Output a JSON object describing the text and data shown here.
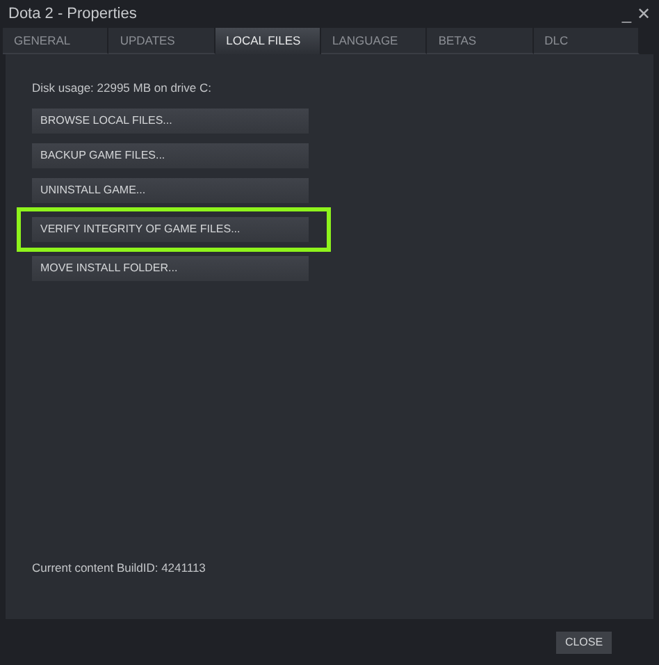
{
  "window": {
    "title": "Dota 2 - Properties",
    "controls": [
      "_",
      "✕"
    ]
  },
  "tabs": [
    {
      "label": "GENERAL",
      "selected": false
    },
    {
      "label": "UPDATES",
      "selected": false
    },
    {
      "label": "LOCAL FILES",
      "selected": true
    },
    {
      "label": "LANGUAGE",
      "selected": false
    },
    {
      "label": "BETAS",
      "selected": false
    },
    {
      "label": "DLC",
      "selected": false
    }
  ],
  "disk_usage": "Disk usage: 22995 MB on drive C:",
  "buttons": [
    {
      "label": "BROWSE LOCAL FILES...",
      "highlighted": false
    },
    {
      "label": "BACKUP GAME FILES...",
      "highlighted": false
    },
    {
      "label": "UNINSTALL GAME...",
      "highlighted": false
    },
    {
      "label": "VERIFY INTEGRITY OF GAME FILES...",
      "highlighted": true
    },
    {
      "label": "MOVE INSTALL FOLDER...",
      "highlighted": false
    }
  ],
  "build_id": "Current content BuildID: 4241113",
  "close_button": "CLOSE"
}
